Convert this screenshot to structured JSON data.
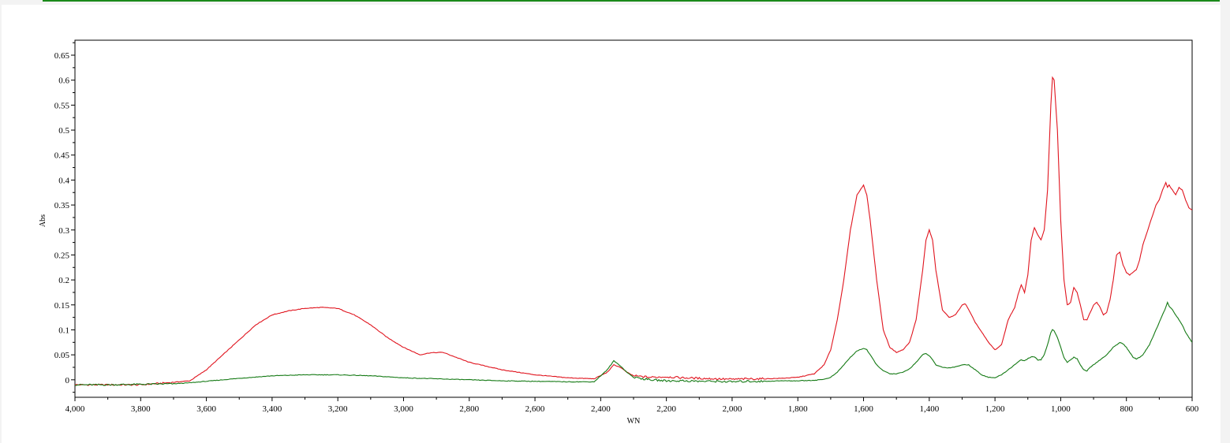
{
  "colors": {
    "accent_bar": "#1a8a1a",
    "series_red": "#e0141e",
    "series_green": "#157a15"
  },
  "chart_data": {
    "type": "line",
    "xlabel": "WN",
    "ylabel": "Abs",
    "xlim": [
      4000,
      600
    ],
    "x_reversed": true,
    "ylim": [
      -0.035,
      0.68
    ],
    "grid": false,
    "legend": "none",
    "x_ticks": [
      4000,
      3800,
      3600,
      3400,
      3200,
      3000,
      2800,
      2600,
      2400,
      2200,
      2000,
      1800,
      1600,
      1400,
      1200,
      1000,
      800,
      600
    ],
    "x_tick_labels": [
      "4,000",
      "3,800",
      "3,600",
      "3,400",
      "3,200",
      "3,000",
      "2,800",
      "2,600",
      "2,400",
      "2,200",
      "2,000",
      "1,800",
      "1,600",
      "1,400",
      "1,200",
      "1,000",
      "800",
      "600"
    ],
    "y_ticks": [
      0,
      0.05,
      0.1,
      0.15,
      0.2,
      0.25,
      0.3,
      0.35,
      0.4,
      0.45,
      0.5,
      0.55,
      0.6,
      0.65
    ],
    "y_tick_labels": [
      "0",
      "0.05",
      "0.1",
      "0.15",
      "0.2",
      "0.25",
      "0.3",
      "0.35",
      "0.4",
      "0.45",
      "0.5",
      "0.55",
      "0.6",
      "0.65"
    ],
    "series": [
      {
        "color": "#e0141e",
        "x": [
          4000,
          3900,
          3800,
          3700,
          3650,
          3600,
          3550,
          3500,
          3450,
          3400,
          3350,
          3300,
          3250,
          3200,
          3150,
          3100,
          3050,
          3000,
          2950,
          2920,
          2880,
          2800,
          2700,
          2600,
          2500,
          2420,
          2380,
          2360,
          2340,
          2320,
          2300,
          2250,
          2200,
          2150,
          2100,
          2050,
          2000,
          1950,
          1900,
          1850,
          1800,
          1750,
          1720,
          1700,
          1680,
          1660,
          1640,
          1620,
          1600,
          1590,
          1580,
          1560,
          1540,
          1520,
          1500,
          1480,
          1460,
          1440,
          1420,
          1410,
          1400,
          1390,
          1380,
          1360,
          1340,
          1320,
          1300,
          1290,
          1280,
          1260,
          1240,
          1220,
          1200,
          1180,
          1160,
          1140,
          1130,
          1120,
          1110,
          1100,
          1090,
          1080,
          1070,
          1060,
          1050,
          1040,
          1030,
          1025,
          1020,
          1010,
          1000,
          990,
          980,
          970,
          960,
          950,
          940,
          930,
          920,
          910,
          900,
          890,
          880,
          870,
          860,
          850,
          840,
          830,
          820,
          810,
          800,
          790,
          780,
          770,
          760,
          750,
          740,
          730,
          720,
          710,
          700,
          690,
          680,
          675,
          670,
          660,
          650,
          640,
          630,
          620,
          610,
          600
        ],
        "y": [
          -0.01,
          -0.01,
          -0.01,
          -0.005,
          -0.002,
          0.02,
          0.05,
          0.08,
          0.11,
          0.13,
          0.138,
          0.143,
          0.145,
          0.143,
          0.13,
          0.11,
          0.085,
          0.065,
          0.05,
          0.054,
          0.055,
          0.035,
          0.02,
          0.01,
          0.004,
          0.002,
          0.015,
          0.03,
          0.025,
          0.015,
          0.008,
          0.005,
          0.006,
          0.004,
          0.003,
          0.002,
          0.001,
          0.002,
          0.002,
          0.003,
          0.005,
          0.012,
          0.03,
          0.06,
          0.12,
          0.2,
          0.3,
          0.37,
          0.39,
          0.37,
          0.32,
          0.2,
          0.1,
          0.065,
          0.055,
          0.06,
          0.075,
          0.12,
          0.22,
          0.28,
          0.3,
          0.28,
          0.22,
          0.14,
          0.125,
          0.13,
          0.15,
          0.152,
          0.14,
          0.115,
          0.095,
          0.075,
          0.06,
          0.07,
          0.12,
          0.145,
          0.17,
          0.19,
          0.175,
          0.21,
          0.28,
          0.305,
          0.29,
          0.28,
          0.3,
          0.38,
          0.55,
          0.605,
          0.6,
          0.5,
          0.32,
          0.2,
          0.15,
          0.155,
          0.185,
          0.175,
          0.15,
          0.12,
          0.12,
          0.135,
          0.15,
          0.155,
          0.145,
          0.13,
          0.135,
          0.16,
          0.2,
          0.25,
          0.255,
          0.23,
          0.215,
          0.21,
          0.215,
          0.22,
          0.24,
          0.27,
          0.29,
          0.31,
          0.33,
          0.35,
          0.36,
          0.38,
          0.395,
          0.385,
          0.39,
          0.38,
          0.37,
          0.385,
          0.38,
          0.36,
          0.345,
          0.34
        ]
      },
      {
        "color": "#157a15",
        "x": [
          4000,
          3900,
          3800,
          3700,
          3650,
          3600,
          3500,
          3400,
          3300,
          3200,
          3100,
          3000,
          2900,
          2800,
          2700,
          2600,
          2500,
          2420,
          2380,
          2360,
          2340,
          2320,
          2300,
          2250,
          2200,
          2150,
          2100,
          2050,
          2000,
          1950,
          1900,
          1850,
          1800,
          1750,
          1720,
          1700,
          1680,
          1660,
          1640,
          1620,
          1600,
          1590,
          1580,
          1560,
          1540,
          1520,
          1500,
          1480,
          1460,
          1440,
          1420,
          1410,
          1400,
          1390,
          1380,
          1360,
          1340,
          1320,
          1300,
          1280,
          1260,
          1240,
          1220,
          1200,
          1180,
          1160,
          1140,
          1130,
          1120,
          1110,
          1100,
          1090,
          1080,
          1070,
          1060,
          1050,
          1040,
          1030,
          1025,
          1020,
          1010,
          1000,
          990,
          980,
          970,
          960,
          950,
          940,
          930,
          920,
          910,
          900,
          880,
          860,
          840,
          820,
          810,
          800,
          790,
          780,
          770,
          760,
          750,
          740,
          730,
          720,
          710,
          700,
          690,
          680,
          675,
          670,
          660,
          650,
          640,
          630,
          620,
          610,
          600
        ],
        "y": [
          -0.01,
          -0.01,
          -0.009,
          -0.008,
          -0.006,
          -0.003,
          0.003,
          0.008,
          0.01,
          0.01,
          0.008,
          0.004,
          0.002,
          0.0,
          -0.002,
          -0.003,
          -0.004,
          -0.004,
          0.02,
          0.038,
          0.028,
          0.015,
          0.005,
          0.0,
          -0.002,
          -0.002,
          -0.003,
          -0.003,
          -0.004,
          -0.003,
          -0.003,
          -0.002,
          -0.002,
          -0.001,
          0.001,
          0.005,
          0.015,
          0.03,
          0.045,
          0.058,
          0.063,
          0.06,
          0.05,
          0.03,
          0.018,
          0.012,
          0.012,
          0.015,
          0.022,
          0.035,
          0.05,
          0.053,
          0.048,
          0.04,
          0.03,
          0.025,
          0.024,
          0.026,
          0.03,
          0.03,
          0.02,
          0.01,
          0.005,
          0.004,
          0.01,
          0.02,
          0.03,
          0.036,
          0.04,
          0.038,
          0.042,
          0.046,
          0.046,
          0.04,
          0.04,
          0.05,
          0.07,
          0.095,
          0.1,
          0.098,
          0.085,
          0.065,
          0.045,
          0.035,
          0.04,
          0.045,
          0.042,
          0.03,
          0.02,
          0.018,
          0.025,
          0.03,
          0.04,
          0.05,
          0.065,
          0.075,
          0.072,
          0.065,
          0.055,
          0.045,
          0.042,
          0.045,
          0.05,
          0.06,
          0.07,
          0.085,
          0.1,
          0.115,
          0.13,
          0.145,
          0.155,
          0.148,
          0.14,
          0.13,
          0.12,
          0.11,
          0.095,
          0.085,
          0.075
        ]
      }
    ]
  }
}
